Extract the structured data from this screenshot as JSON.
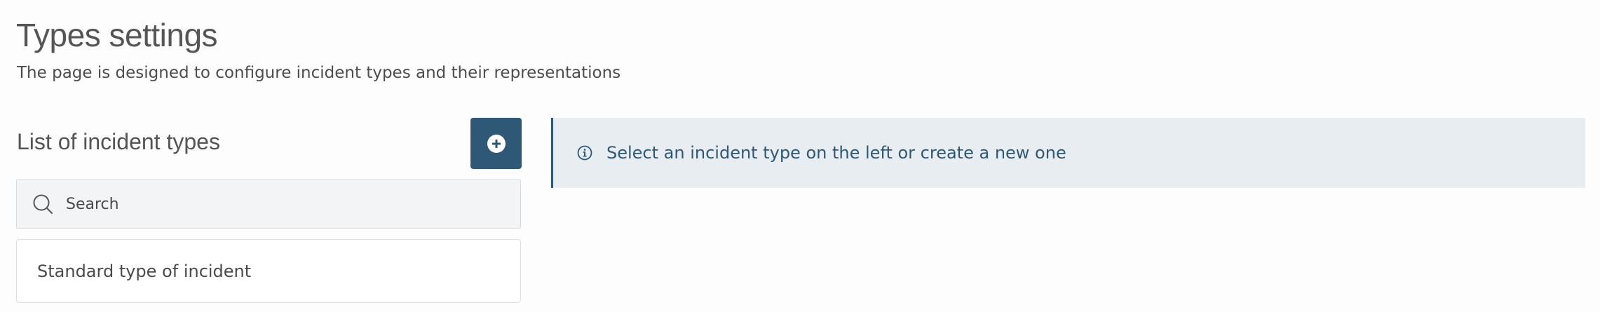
{
  "page": {
    "title": "Types settings",
    "subtitle": "The page is designed to configure incident types and their representations"
  },
  "list": {
    "heading": "List of incident types",
    "add_button_icon": "plus-circle-icon",
    "search": {
      "icon": "search-icon",
      "placeholder": "Search",
      "value": ""
    },
    "items": [
      {
        "label": "Standard type of incident"
      }
    ]
  },
  "info_banner": {
    "icon": "info-icon",
    "text": "Select an incident type on the left or create a new one"
  },
  "colors": {
    "accent": "#2f5877",
    "banner_background": "#e8edf1",
    "search_background": "#f3f4f5"
  }
}
